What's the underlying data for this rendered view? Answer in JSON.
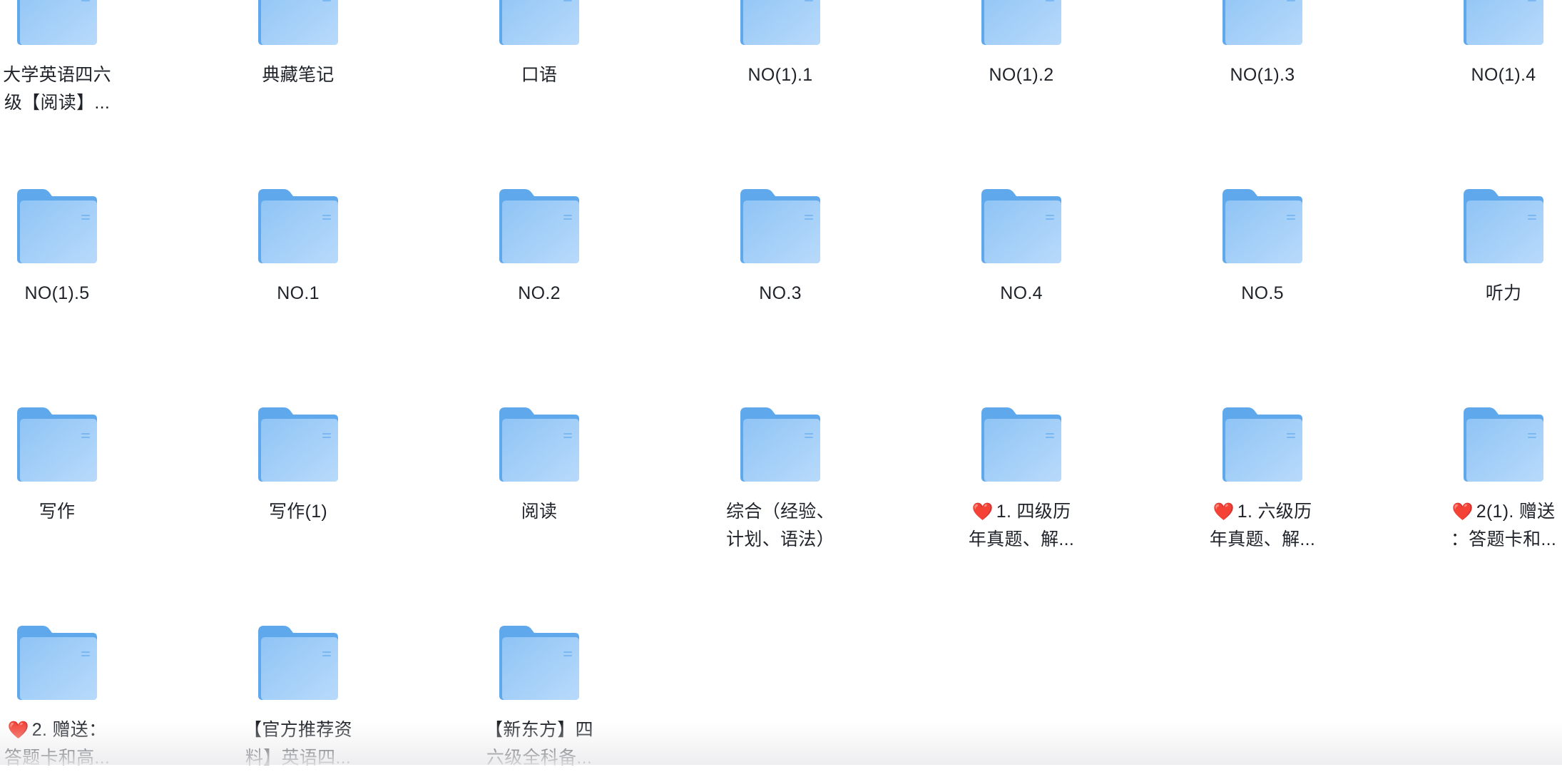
{
  "colors": {
    "folder_back": "#5fa8ec",
    "folder_front_top": "#8fc4f5",
    "folder_front_bottom": "#b8dafb",
    "heart": "#e5323d",
    "text": "#1f2329"
  },
  "icons": {
    "folder": "folder-icon",
    "heart": "heart-icon"
  },
  "folders": [
    {
      "label": "大学英语四六级【阅读】...",
      "line1": "大学英语四六",
      "line2": "级【阅读】..."
    },
    {
      "label": "典藏笔记",
      "line1": "典藏笔记",
      "line2": ""
    },
    {
      "label": "口语",
      "line1": "口语",
      "line2": ""
    },
    {
      "label": "NO(1).1",
      "line1": "NO(1).1",
      "line2": ""
    },
    {
      "label": "NO(1).2",
      "line1": "NO(1).2",
      "line2": ""
    },
    {
      "label": "NO(1).3",
      "line1": "NO(1).3",
      "line2": ""
    },
    {
      "label": "NO(1).4",
      "line1": "NO(1).4",
      "line2": ""
    },
    {
      "label": "NO(1).5",
      "line1": "NO(1).5",
      "line2": ""
    },
    {
      "label": "NO.1",
      "line1": "NO.1",
      "line2": ""
    },
    {
      "label": "NO.2",
      "line1": "NO.2",
      "line2": ""
    },
    {
      "label": "NO.3",
      "line1": "NO.3",
      "line2": ""
    },
    {
      "label": "NO.4",
      "line1": "NO.4",
      "line2": ""
    },
    {
      "label": "NO.5",
      "line1": "NO.5",
      "line2": ""
    },
    {
      "label": "听力",
      "line1": "听力",
      "line2": ""
    },
    {
      "label": "写作",
      "line1": "写作",
      "line2": ""
    },
    {
      "label": "写作(1)",
      "line1": "写作(1)",
      "line2": ""
    },
    {
      "label": "阅读",
      "line1": "阅读",
      "line2": ""
    },
    {
      "label": "综合（经验、计划、语法）",
      "line1": "综合（经验、",
      "line2": "计划、语法）"
    },
    {
      "label": "1. 四级历年真题、解...",
      "heart": "❤️",
      "line1": "1. 四级历",
      "line2": "年真题、解..."
    },
    {
      "label": "1. 六级历年真题、解...",
      "heart": "❤️",
      "line1": "1. 六级历",
      "line2": "年真题、解..."
    },
    {
      "label": "2(1). 赠送：答题卡和...",
      "heart": "❤️",
      "line1": "2(1). 赠送",
      "line2": "：答题卡和..."
    },
    {
      "label": "2. 赠送：答题卡和高...",
      "heart": "❤️",
      "line1": "2. 赠送：",
      "line2": "答题卡和高..."
    },
    {
      "label": "【官方推荐资料】英语四...",
      "line1": "【官方推荐资",
      "line2": "料】英语四..."
    },
    {
      "label": "【新东方】四六级全科备...",
      "line1": "【新东方】四",
      "line2": "六级全科备..."
    }
  ]
}
